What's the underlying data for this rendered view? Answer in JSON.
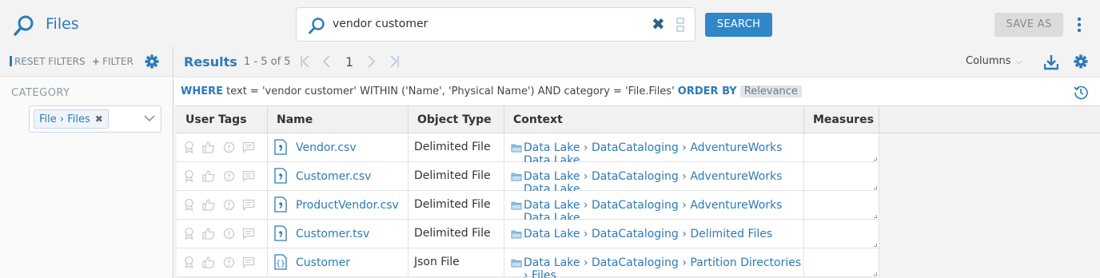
{
  "app": {
    "title": "Files"
  },
  "search": {
    "query": "vendor customer",
    "clear": "✖",
    "button": "SEARCH"
  },
  "toolbar": {
    "save_as": "SAVE AS"
  },
  "filters": {
    "reset": "RESET FILTERS",
    "add": "FILTER",
    "category_label": "CATEGORY",
    "category_value": "File › Files",
    "category_remove": "✖"
  },
  "results": {
    "title": "Results",
    "range": "1 - 5 of 5",
    "page": "1",
    "columns_label": "Columns"
  },
  "query": {
    "where_kw": "WHERE",
    "clause": "text = 'vendor customer' WITHIN ('Name', 'Physical Name') AND category = 'File.Files'",
    "order_kw": "ORDER BY",
    "order_value": "Relevance"
  },
  "table": {
    "headers": [
      "User Tags",
      "Name",
      "Object Type",
      "Context",
      "Measures"
    ],
    "rows": [
      {
        "name": "Vendor.csv",
        "type": "Delimited File",
        "context": "Data Lake › DataCataloging › AdventureWorks Data Lake",
        "icon": "delimited-file-icon"
      },
      {
        "name": "Customer.csv",
        "type": "Delimited File",
        "context": "Data Lake › DataCataloging › AdventureWorks Data Lake",
        "icon": "delimited-file-icon"
      },
      {
        "name": "ProductVendor.csv",
        "type": "Delimited File",
        "context": "Data Lake › DataCataloging › AdventureWorks Data Lake",
        "icon": "delimited-file-icon"
      },
      {
        "name": "Customer.tsv",
        "type": "Delimited File",
        "context": "Data Lake › DataCataloging › Delimited Files",
        "icon": "delimited-file-icon"
      },
      {
        "name": "Customer",
        "type": "Json File",
        "context": "Data Lake › DataCataloging › Partition Directories › Files",
        "icon": "json-file-icon"
      }
    ]
  },
  "colors": {
    "accent": "#2d7ab8",
    "button": "#2f86c8",
    "muted": "#b6c9dc"
  }
}
